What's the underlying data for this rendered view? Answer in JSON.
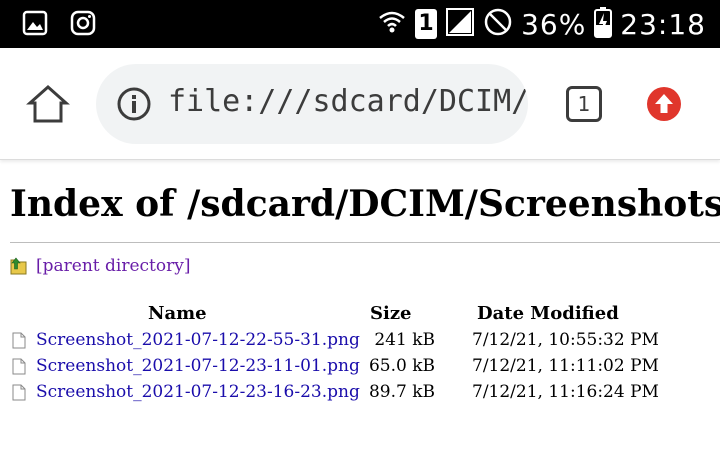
{
  "status_bar": {
    "icons": [
      "gallery-icon",
      "instagram-icon",
      "wifi-icon",
      "sim-1-icon",
      "signal-icon",
      "do-not-disturb-icon",
      "battery-charging-icon"
    ],
    "sim_label": "1",
    "battery": "36%",
    "time": "23:18"
  },
  "browser": {
    "url": "file:///sdcard/DCIM/Screenshots/",
    "tab_count": "1",
    "icons": [
      "home-icon",
      "info-icon",
      "tab-switcher-icon",
      "update-arrow-icon"
    ],
    "update_color": "#e0362c"
  },
  "page": {
    "title": "Index of /sdcard/DCIM/Screenshots/",
    "parent_link": "[parent directory]",
    "columns": {
      "name": "Name",
      "size": "Size",
      "date": "Date Modified"
    },
    "files": [
      {
        "name": "Screenshot_2021-07-12-22-55-31.png",
        "size": "241 kB",
        "date": "7/12/21, 10:55:32 PM"
      },
      {
        "name": "Screenshot_2021-07-12-23-11-01.png",
        "size": "65.0 kB",
        "date": "7/12/21, 11:11:02 PM"
      },
      {
        "name": "Screenshot_2021-07-12-23-16-23.png",
        "size": "89.7 kB",
        "date": "7/12/21, 11:16:24 PM"
      }
    ]
  }
}
